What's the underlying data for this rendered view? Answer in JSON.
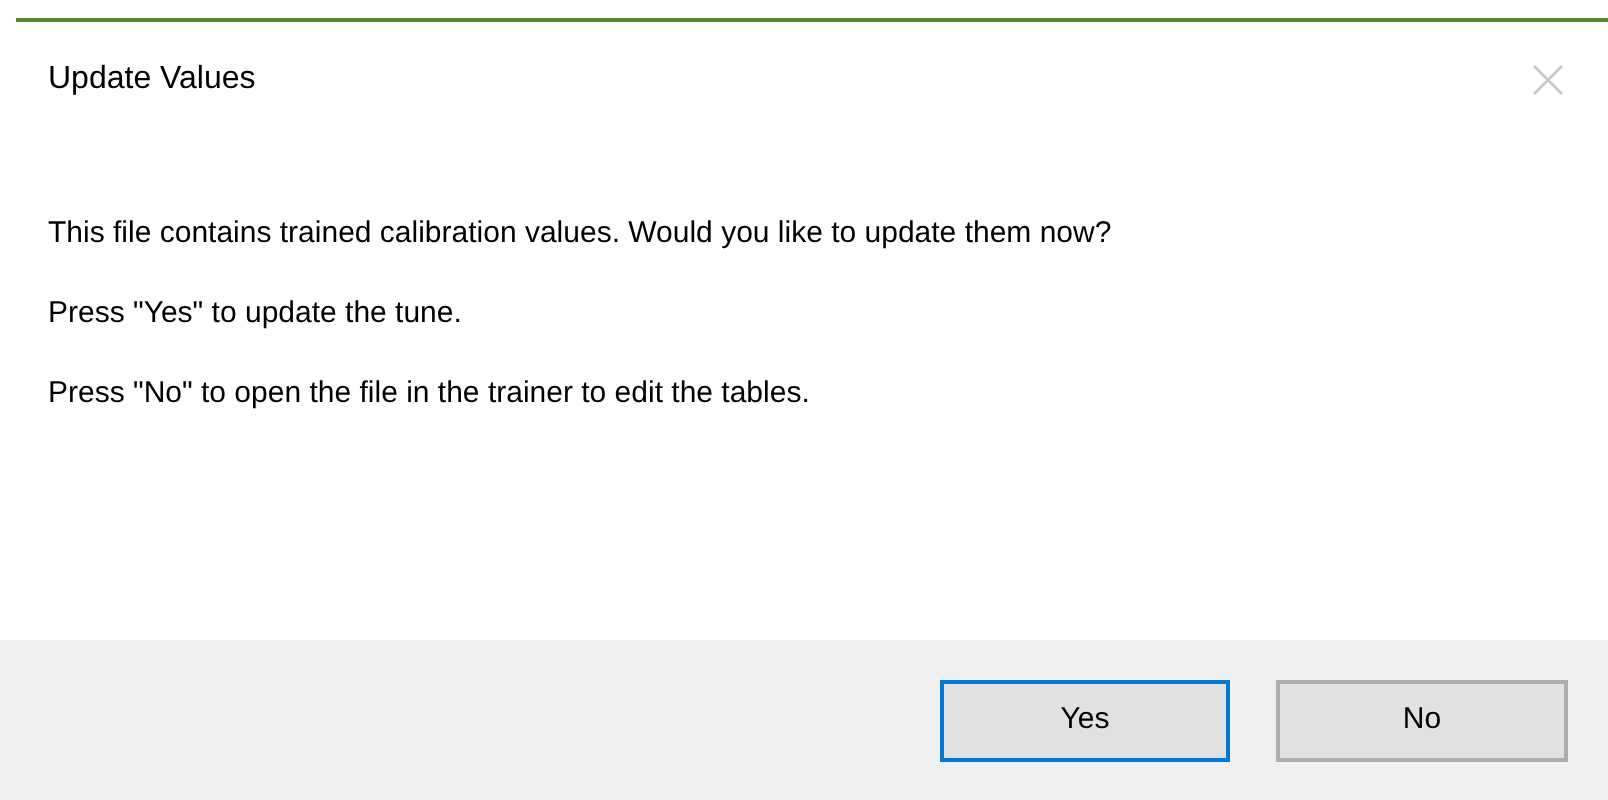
{
  "window": {
    "title": "Update Values"
  },
  "message": [
    "This file contains trained calibration values. Would you like to update them now?",
    "Press \"Yes\" to update the tune.",
    "Press \"No\" to open the file in the trainer to edit the tables."
  ],
  "buttons": [
    {
      "label": "Yes",
      "focused": true
    },
    {
      "label": "No",
      "focused": false
    }
  ]
}
